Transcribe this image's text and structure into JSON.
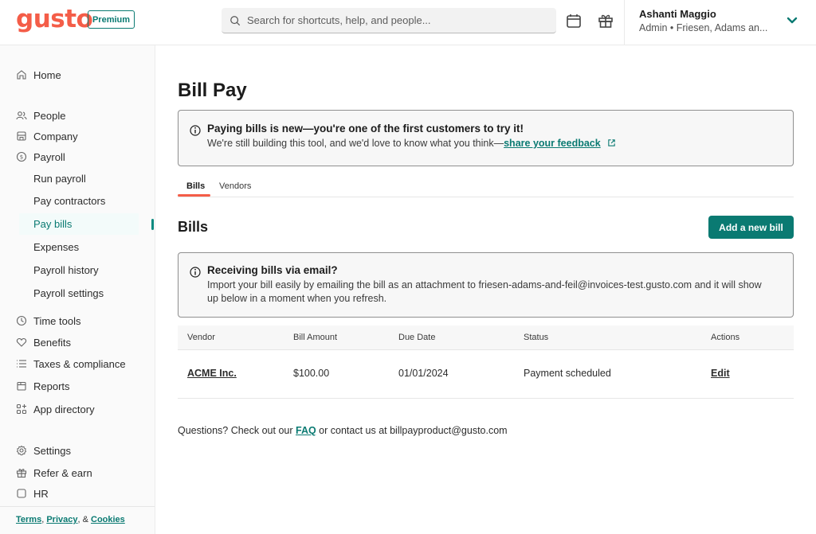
{
  "header": {
    "logo": "gusto",
    "plan_badge": "Premium",
    "search_placeholder": "Search for shortcuts, help, and people...",
    "user_name": "Ashanti Maggio",
    "user_subtitle": "Admin • Friesen, Adams an..."
  },
  "sidebar": {
    "home": "Home",
    "people": "People",
    "company": "Company",
    "payroll": "Payroll",
    "payroll_sub": [
      "Run payroll",
      "Pay contractors",
      "Pay bills",
      "Expenses",
      "Payroll history",
      "Payroll settings"
    ],
    "time_tools": "Time tools",
    "benefits": "Benefits",
    "taxes": "Taxes & compliance",
    "reports": "Reports",
    "app_directory": "App directory",
    "settings": "Settings",
    "refer": "Refer & earn",
    "hr": "HR",
    "footer": {
      "terms": "Terms",
      "sep1": ", ",
      "privacy": "Privacy",
      "sep2": ", & ",
      "cookies": "Cookies"
    }
  },
  "main": {
    "title": "Bill Pay",
    "new_alert": {
      "title": "Paying bills is new—you're one of the first customers to try it!",
      "body": "We're still building this tool, and we'd love to know what you think—",
      "link": "share your feedback"
    },
    "tabs": [
      "Bills",
      "Vendors"
    ],
    "section_title": "Bills",
    "add_button": "Add a new bill",
    "email_alert": {
      "title": "Receiving bills via email?",
      "body": "Import your bill easily by emailing the bill as an attachment to friesen-adams-and-feil@invoices-test.gusto.com and it will show up below in a moment when you refresh."
    },
    "table": {
      "headers": [
        "Vendor",
        "Bill Amount",
        "Due Date",
        "Status",
        "Actions"
      ],
      "rows": [
        {
          "vendor": "ACME Inc.",
          "amount": "$100.00",
          "due_date": "01/01/2024",
          "status": "Payment scheduled",
          "action": "Edit"
        }
      ]
    },
    "footer": {
      "prefix": "Questions? Check out our ",
      "faq": "FAQ",
      "suffix": " or contact us at billpayproduct@gusto.com"
    }
  },
  "colors": {
    "brand": "#f45d48",
    "accent": "#0a7a72"
  }
}
